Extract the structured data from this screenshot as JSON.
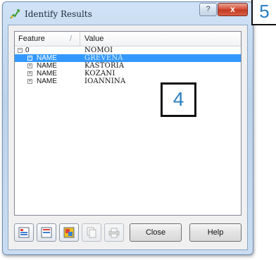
{
  "window": {
    "title": "Identify Results",
    "help_glyph": "?",
    "close_glyph": "x"
  },
  "tree": {
    "columns": {
      "feature": "Feature",
      "value": "Value",
      "sort_indicator": "/"
    },
    "root": {
      "expander": "−",
      "feature": "0",
      "value": "NOMOI"
    },
    "rows": [
      {
        "expander": "+",
        "feature": "NAME",
        "value": "GREVENA",
        "selected": true
      },
      {
        "expander": "+",
        "feature": "NAME",
        "value": "KASTORIA",
        "selected": false
      },
      {
        "expander": "+",
        "feature": "NAME",
        "value": "KOZANI",
        "selected": false
      },
      {
        "expander": "+",
        "feature": "NAME",
        "value": "IOANNINA",
        "selected": false
      }
    ]
  },
  "annotations": {
    "label_4": "4",
    "label_5": "5"
  },
  "buttons": {
    "close": "Close",
    "help": "Help"
  },
  "toolbar_icons": [
    "expand-tree-icon",
    "collapse-tree-icon",
    "layer-color-icon",
    "copy-icon",
    "print-icon"
  ],
  "colors": {
    "selection": "#3399ff",
    "annotation_text": "#2a7fc1",
    "close_button": "#c33a22"
  }
}
